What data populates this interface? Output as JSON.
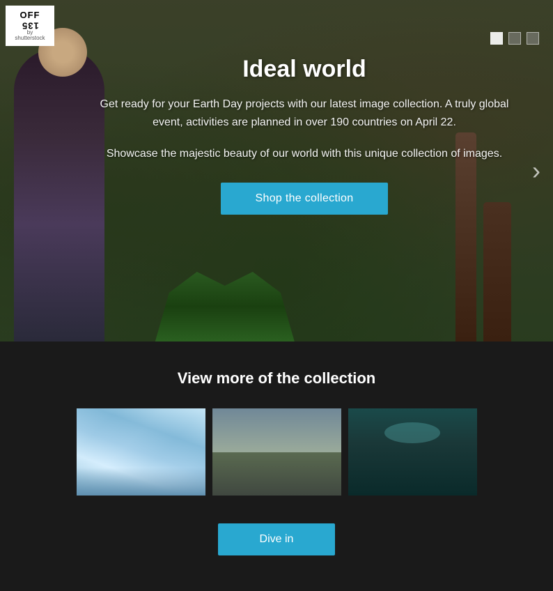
{
  "logo": {
    "text_top": "OFF",
    "text_bottom": "135",
    "by": "by",
    "brand": "shutterstock"
  },
  "hero": {
    "title": "Ideal world",
    "description": "Get ready for your Earth Day projects with our latest image collection. A truly global event, activities are planned in over 190 countries on April 22.",
    "subtitle": "Showcase the majestic beauty of our world with this unique collection of images.",
    "cta_label": "Shop the collection",
    "next_arrow": "›"
  },
  "pagination": {
    "dots": [
      "active",
      "inactive",
      "inactive"
    ]
  },
  "bottom": {
    "section_title": "View more of the collection",
    "dive_label": "Dive in"
  },
  "colors": {
    "cta_bg": "#29a8d0",
    "page_bg": "#1a1a1a",
    "text_white": "#ffffff"
  }
}
